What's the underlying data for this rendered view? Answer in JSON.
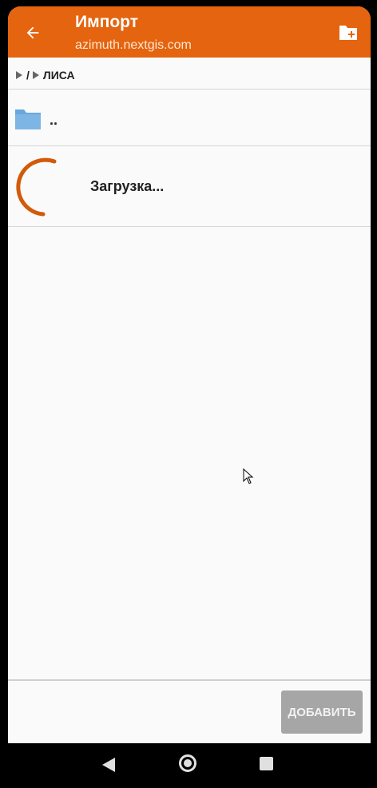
{
  "appbar": {
    "title": "Импорт",
    "subtitle": "azimuth.nextgis.com",
    "back_icon": "arrow-left-icon",
    "new_folder_icon": "folder-plus-icon",
    "color": "#e4640f"
  },
  "breadcrumb": {
    "items": [
      "/",
      "ЛИСА"
    ]
  },
  "list": {
    "up_label": "..",
    "loading_label": "Загрузка...",
    "folder_color": "#6aa8dc",
    "spinner_color": "#d25a0a"
  },
  "footer": {
    "add_label": "ДОБАВИТЬ"
  },
  "navbar": {
    "icons": [
      "back-triangle-icon",
      "home-circle-icon",
      "recents-square-icon"
    ]
  }
}
